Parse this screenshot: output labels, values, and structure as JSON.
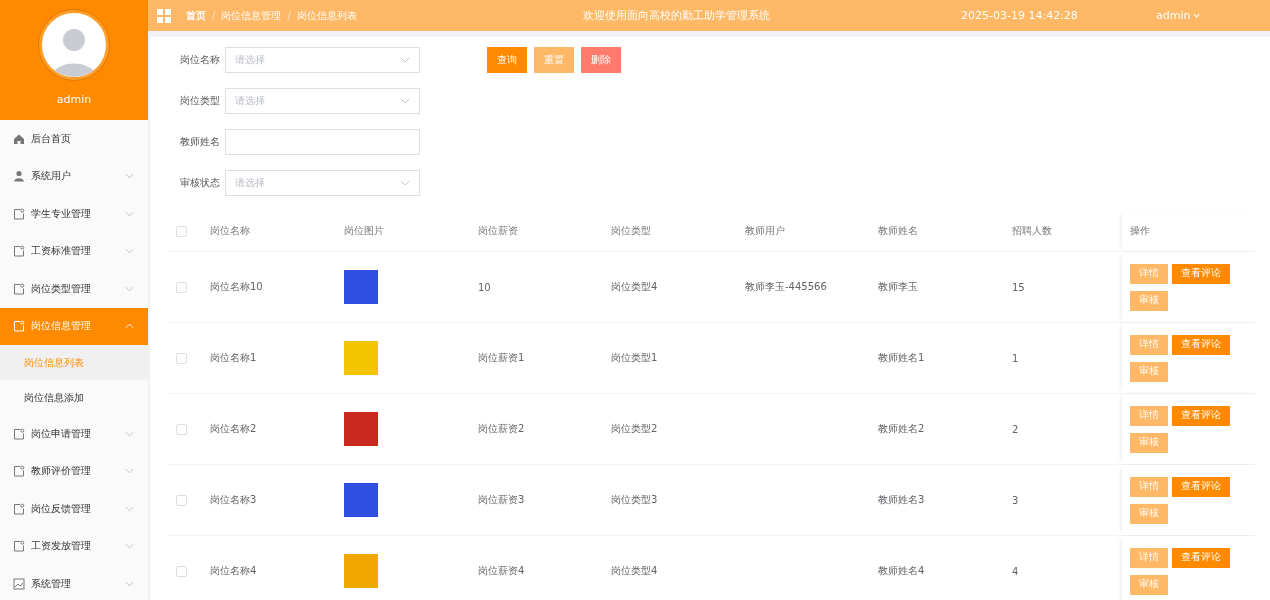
{
  "sidebar": {
    "username": "admin",
    "items": [
      {
        "label": "后台首页",
        "kind": "home",
        "expanded": false
      },
      {
        "label": "系统用户",
        "kind": "user",
        "expanded": false
      },
      {
        "label": "学生专业管理",
        "kind": "doc",
        "expanded": false
      },
      {
        "label": "工资标准管理",
        "kind": "doc",
        "expanded": false
      },
      {
        "label": "岗位类型管理",
        "kind": "doc",
        "expanded": false
      },
      {
        "label": "岗位信息管理",
        "kind": "doc",
        "expanded": true,
        "children": [
          {
            "label": "岗位信息列表",
            "selected": true
          },
          {
            "label": "岗位信息添加",
            "selected": false
          }
        ]
      },
      {
        "label": "岗位申请管理",
        "kind": "doc",
        "expanded": false
      },
      {
        "label": "教师评价管理",
        "kind": "doc",
        "expanded": false
      },
      {
        "label": "岗位反馈管理",
        "kind": "doc",
        "expanded": false
      },
      {
        "label": "工资发放管理",
        "kind": "doc",
        "expanded": false
      },
      {
        "label": "系统管理",
        "kind": "image",
        "expanded": false
      }
    ]
  },
  "topbar": {
    "breadcrumb": [
      "首页",
      "岗位信息管理",
      "岗位信息列表"
    ],
    "separator": "/",
    "title": "欢迎使用面向高校的勤工助学管理系统",
    "datetime": "2025-03-19 14:42:28",
    "user": "admin"
  },
  "filters": [
    {
      "label": "岗位名称",
      "kind": "select",
      "placeholder": "请选择"
    },
    {
      "label": "岗位类型",
      "kind": "select",
      "placeholder": "请选择"
    },
    {
      "label": "教师姓名",
      "kind": "input"
    },
    {
      "label": "审核状态",
      "kind": "select",
      "placeholder": "请选择"
    }
  ],
  "actions": [
    {
      "label": "查询",
      "kind": "primary"
    },
    {
      "label": "重置",
      "kind": "light"
    },
    {
      "label": "删除",
      "kind": "danger"
    }
  ],
  "table": {
    "header_checked": false,
    "columns": [
      "岗位名称",
      "岗位图片",
      "岗位薪资",
      "岗位类型",
      "教师用户",
      "教师姓名",
      "招聘人数",
      "操作"
    ],
    "rows": [
      {
        "checked": false,
        "name": "岗位名称10",
        "color": "#2f4fe0",
        "salary": "10",
        "type": "岗位类型4",
        "teacher_user": "教师李玉-445566",
        "teacher_name": "教师李玉",
        "count": "15",
        "actions": [
          {
            "label": "详情",
            "kind": "light"
          },
          {
            "label": "查看评论",
            "kind": "primary"
          },
          {
            "label": "审核",
            "kind": "light"
          }
        ]
      },
      {
        "checked": false,
        "name": "岗位名称1",
        "color": "#f5c400",
        "salary": "岗位薪资1",
        "type": "岗位类型1",
        "teacher_name": "教师姓名1",
        "count": "1",
        "actions": [
          {
            "label": "详情",
            "kind": "light"
          },
          {
            "label": "查看评论",
            "kind": "primary"
          },
          {
            "label": "审核",
            "kind": "light"
          }
        ]
      },
      {
        "checked": false,
        "name": "岗位名称2",
        "color": "#c8281e",
        "salary": "岗位薪资2",
        "type": "岗位类型2",
        "teacher_name": "教师姓名2",
        "count": "2",
        "actions": [
          {
            "label": "详情",
            "kind": "light"
          },
          {
            "label": "查看评论",
            "kind": "primary"
          },
          {
            "label": "审核",
            "kind": "light"
          }
        ]
      },
      {
        "checked": false,
        "name": "岗位名称3",
        "color": "#2f4fe0",
        "salary": "岗位薪资3",
        "type": "岗位类型3",
        "teacher_name": "教师姓名3",
        "count": "3",
        "actions": [
          {
            "label": "详情",
            "kind": "light"
          },
          {
            "label": "查看评论",
            "kind": "primary"
          },
          {
            "label": "审核",
            "kind": "light"
          }
        ]
      },
      {
        "checked": false,
        "name": "岗位名称4",
        "color": "#f0a800",
        "salary": "岗位薪资4",
        "type": "岗位类型4",
        "teacher_name": "教师姓名4",
        "count": "4",
        "actions": [
          {
            "label": "详情",
            "kind": "light"
          },
          {
            "label": "查看评论",
            "kind": "primary"
          },
          {
            "label": "审核",
            "kind": "light"
          }
        ]
      }
    ]
  }
}
